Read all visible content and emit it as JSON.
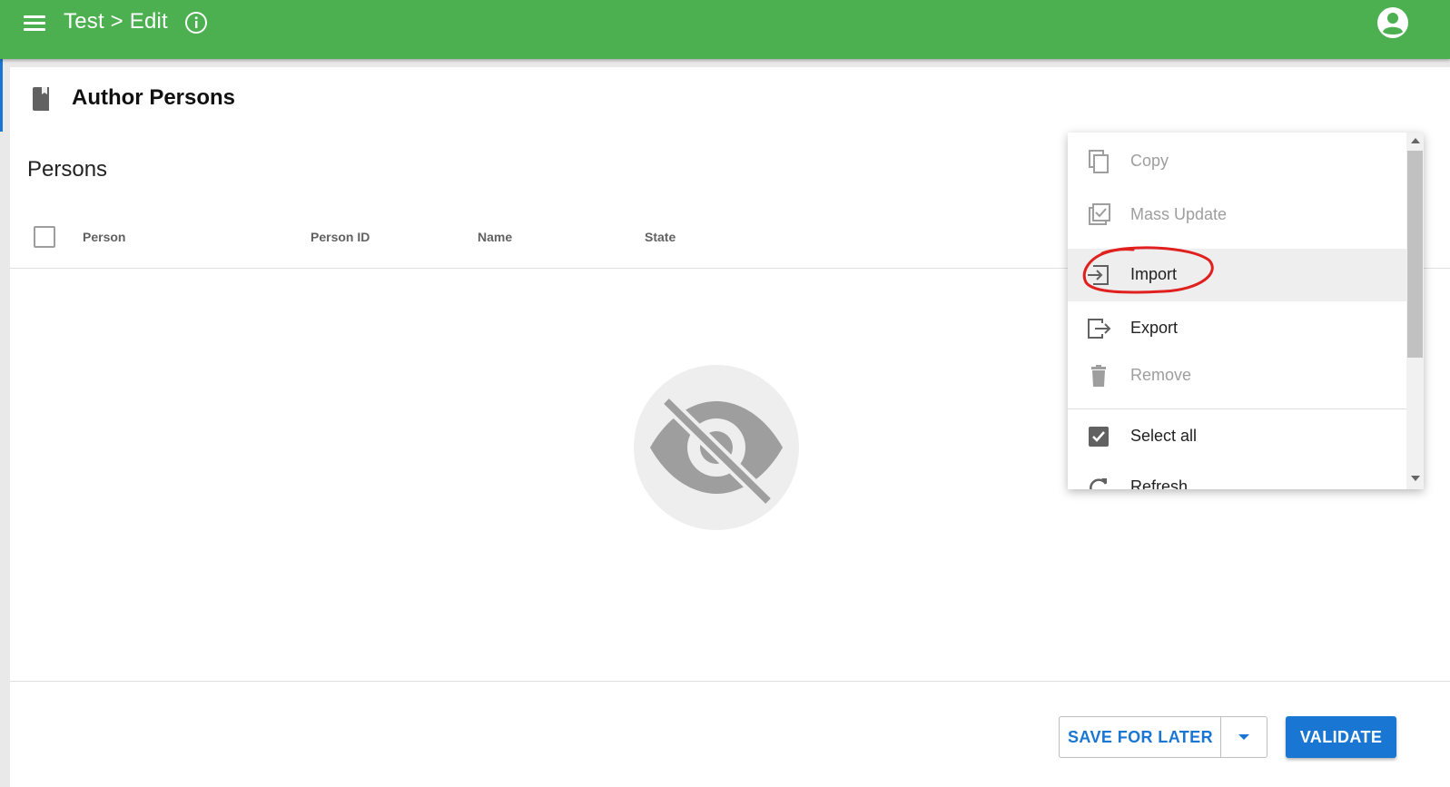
{
  "appbar": {
    "title": "Test > Edit",
    "color": "#4caf50"
  },
  "page": {
    "heading": "Author Persons",
    "section_title": "Persons"
  },
  "table": {
    "columns": [
      "Person",
      "Person ID",
      "Name",
      "State"
    ]
  },
  "context_menu": {
    "items": [
      {
        "label": "Copy",
        "icon": "copy-icon",
        "enabled": false
      },
      {
        "label": "Mass Update",
        "icon": "mass-update-icon",
        "enabled": false
      },
      {
        "label": "Import",
        "icon": "import-icon",
        "enabled": true,
        "highlighted": true
      },
      {
        "label": "Export",
        "icon": "export-icon",
        "enabled": true
      },
      {
        "label": "Remove",
        "icon": "trash-icon",
        "enabled": false
      },
      {
        "label": "Select all",
        "icon": "checkbox-checked-icon",
        "enabled": true
      },
      {
        "label": "Refresh",
        "icon": "refresh-icon",
        "enabled": true
      }
    ]
  },
  "footer": {
    "save_label": "SAVE FOR LATER",
    "validate_label": "VALIDATE",
    "accent": "#1976d2"
  },
  "annotation_color": "#e0201f"
}
